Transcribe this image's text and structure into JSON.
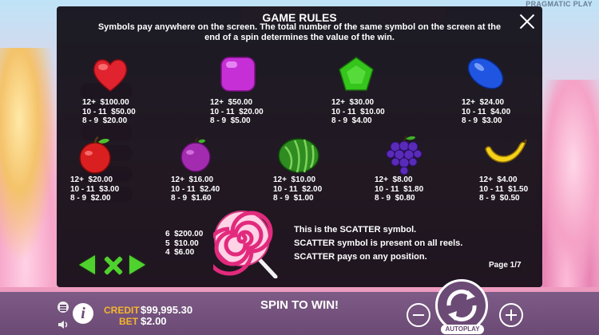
{
  "provider": "PRAGMATIC PLAY",
  "rules": {
    "title": "GAME RULES",
    "description_line1": "Symbols pay anywhere on the screen. The total number of the same symbol on the screen at the",
    "description_line2": "end of a spin determines the value of the win.",
    "page": "Page 1/7"
  },
  "symbols": [
    {
      "name": "red-heart",
      "color": "#e0232e",
      "paytable": [
        "12+  $100.00",
        "10 - 11  $50.00",
        "8 - 9  $20.00"
      ]
    },
    {
      "name": "purple-square",
      "color": "#c62fd6",
      "paytable": [
        "12+  $50.00",
        "10 - 11  $20.00",
        "8 - 9  $5.00"
      ]
    },
    {
      "name": "green-pentagon",
      "color": "#35c51c",
      "paytable": [
        "12+  $30.00",
        "10 - 11  $10.00",
        "8 - 9  $4.00"
      ]
    },
    {
      "name": "blue-oval",
      "color": "#1f55e0",
      "paytable": [
        "12+  $24.00",
        "10 - 11  $4.00",
        "8 - 9  $3.00"
      ]
    },
    {
      "name": "apple",
      "color": "#d91f1f",
      "paytable": [
        "12+  $20.00",
        "10 - 11  $3.00",
        "8 - 9  $2.00"
      ]
    },
    {
      "name": "plum",
      "color": "#a32bb0",
      "paytable": [
        "12+  $16.00",
        "10 - 11  $2.40",
        "8 - 9  $1.60"
      ]
    },
    {
      "name": "watermelon",
      "color": "#2f8c21",
      "paytable": [
        "12+  $10.00",
        "10 - 11  $2.00",
        "8 - 9  $1.00"
      ]
    },
    {
      "name": "grapes",
      "color": "#5a2bb8",
      "paytable": [
        "12+  $8.00",
        "10 - 11  $1.80",
        "8 - 9  $0.80"
      ]
    },
    {
      "name": "banana",
      "color": "#f6d21a",
      "paytable": [
        "12+  $4.00",
        "10 - 11  $1.50",
        "8 - 9  $0.50"
      ]
    }
  ],
  "scatter": {
    "paytable": [
      "6  $200.00",
      "5  $10.00",
      "4  $6.00"
    ],
    "line1": "This is the SCATTER symbol.",
    "line2": "SCATTER symbol is present on all reels.",
    "line3": "SCATTER pays on any position."
  },
  "bottom": {
    "credit_label": "CREDIT",
    "credit_value": "$99,995.30",
    "bet_label": "BET",
    "bet_value": "$2.00",
    "message": "SPIN TO WIN!",
    "autoplay_label": "AUTOPLAY"
  }
}
